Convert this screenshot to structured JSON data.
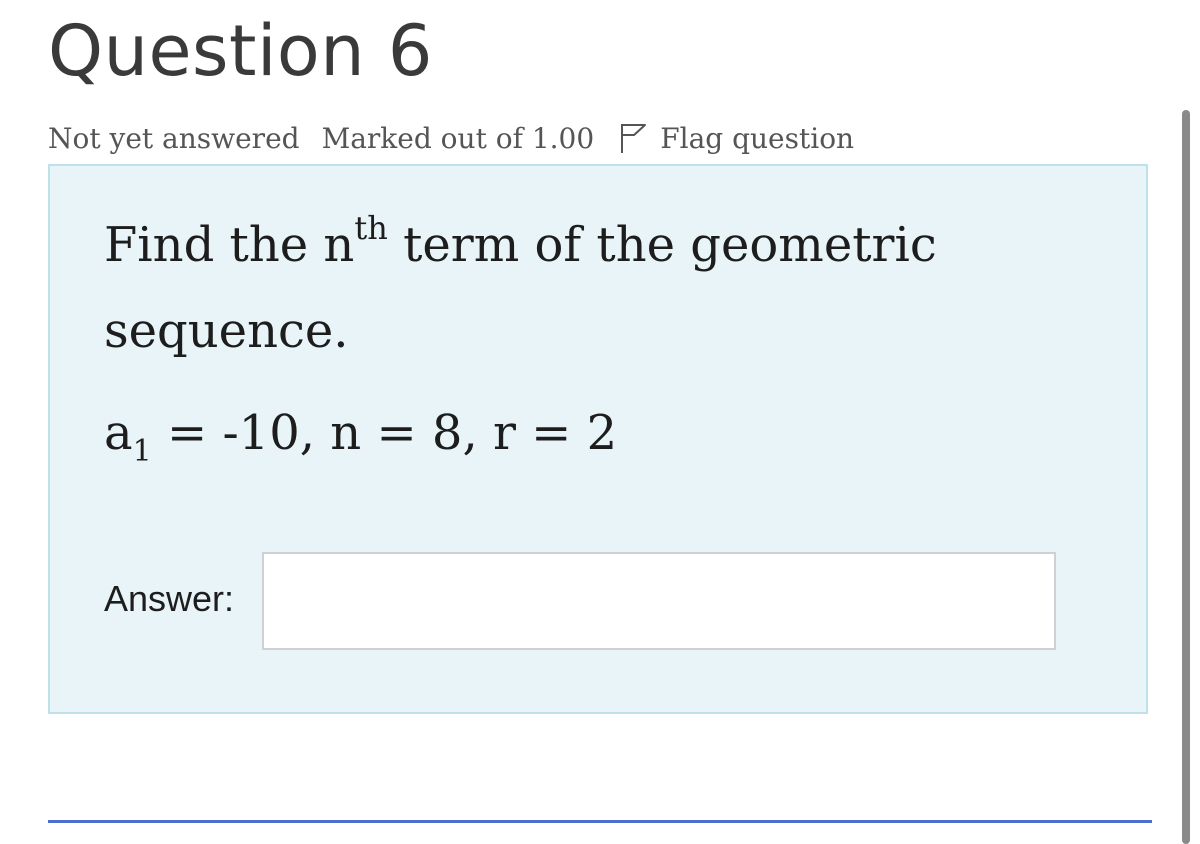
{
  "question": {
    "title": "Question 6",
    "status": "Not yet answered",
    "marks": "Marked out of 1.00",
    "flag_label": "Flag question"
  },
  "prompt": {
    "before_sup": "Find the n",
    "sup": "th",
    "after_sup": " term of the geometric sequence."
  },
  "formula": {
    "a": "a",
    "sub": "1",
    "rest": " = -10, n = 8, r = 2"
  },
  "answer": {
    "label": "Answer:",
    "value": ""
  },
  "icons": {
    "flag": "flag-icon"
  },
  "colors": {
    "box_background": "#e8f4f7",
    "box_border": "#bfe2ea",
    "accent_line": "#4a6fd0"
  }
}
